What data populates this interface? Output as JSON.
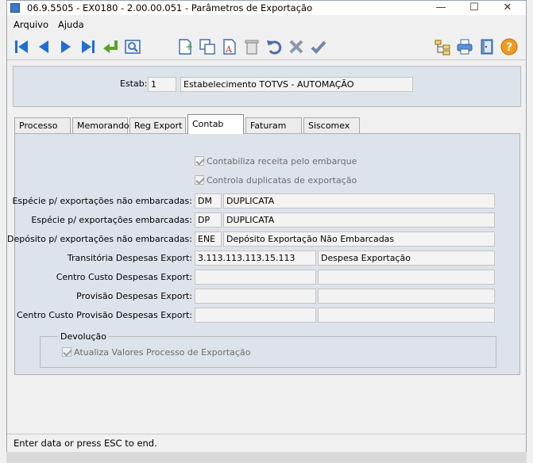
{
  "window": {
    "title": "06.9.5505 - EX0180 - 2.00.00.051 - Parâmetros de Exportação",
    "minimize_glyph": "—",
    "maximize_glyph": "☐",
    "close_glyph": "✕"
  },
  "menu": {
    "items": [
      "Arquivo",
      "Ajuda"
    ]
  },
  "toolbar": {
    "buttons": [
      "first-icon",
      "prev-icon",
      "next-icon",
      "last-icon",
      "goto-icon",
      "search-icon",
      "new-icon",
      "copy-icon",
      "edit-icon",
      "delete-icon",
      "undo-icon",
      "cancel-icon",
      "save-icon",
      "tree-icon",
      "print-icon",
      "exit-icon",
      "help-icon"
    ],
    "colors": {
      "nav_blue": "#1f6fd1",
      "goto_green": "#5aa02c",
      "help_orange": "#f29a1d"
    }
  },
  "estab": {
    "label": "Estab:",
    "code": "1",
    "name": "Estabelecimento TOTVS - AUTOMAÇÃO"
  },
  "tabs": [
    "Processo",
    "Memorando",
    "Reg Export",
    "Contab",
    "Faturam",
    "Siscomex"
  ],
  "active_tab": "Contab",
  "contab": {
    "checkbox_receita": "Contabiliza receita pelo embarque",
    "checkbox_duplicatas": "Controla duplicatas de exportação",
    "especie_nao_emb": {
      "label": "Espécie p/ exportações não embarcadas:",
      "code": "DM",
      "desc": "DUPLICATA"
    },
    "especie_emb": {
      "label": "Espécie p/ exportações embarcadas:",
      "code": "DP",
      "desc": "DUPLICATA"
    },
    "deposito": {
      "label": "Depósito p/ exportações não embarcadas:",
      "code": "ENE",
      "desc": "Depósito Exportação Não Embarcadas"
    },
    "transitoria": {
      "label": "Transitória Despesas Export:",
      "code": "3.113.113.113.15.113",
      "desc": "Despesa Exportação"
    },
    "centro_custo": {
      "label": "Centro Custo Despesas Export:",
      "code": "",
      "desc": ""
    },
    "provisao": {
      "label": "Provisão Despesas Export:",
      "code": "",
      "desc": ""
    },
    "centro_custo_prov": {
      "label": "Centro Custo Provisão Despesas Export:",
      "code": "",
      "desc": ""
    },
    "devolucao": {
      "title": "Devolução",
      "checkbox": "Atualiza Valores Processo de Exportação"
    }
  },
  "status": {
    "text": "Enter data or press ESC to end."
  }
}
